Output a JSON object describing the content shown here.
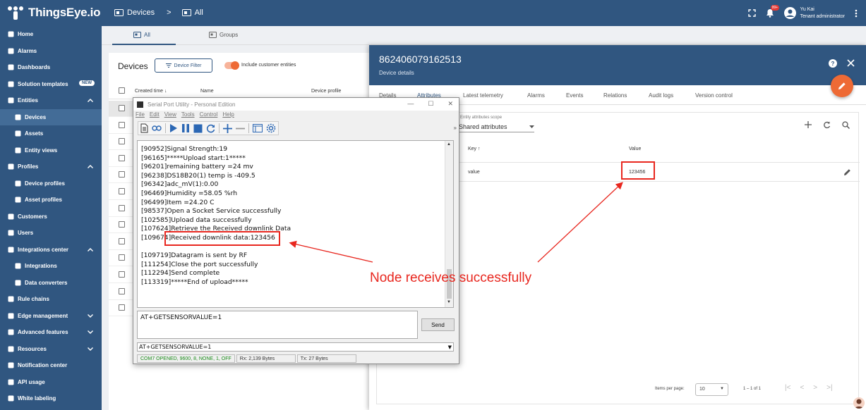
{
  "topbar": {
    "logo_text": "ThingsEye.io",
    "crumb1": "Devices",
    "crumb_sep": ">",
    "crumb2": "All",
    "notif_badge": "99+",
    "user_name": "Yu Kai",
    "user_role": "Tenant administrator"
  },
  "sidebar": {
    "items": [
      {
        "label": "Home",
        "icon": "home-icon"
      },
      {
        "label": "Alarms",
        "icon": "alarm-icon"
      },
      {
        "label": "Dashboards",
        "icon": "dashboard-icon"
      },
      {
        "label": "Solution templates",
        "icon": "template-icon",
        "badge": "NEW"
      },
      {
        "label": "Entities",
        "icon": "entities-icon",
        "chevron": "up"
      },
      {
        "label": "Devices",
        "icon": "device-icon",
        "sub": true,
        "active": true
      },
      {
        "label": "Assets",
        "icon": "asset-icon",
        "sub": true
      },
      {
        "label": "Entity views",
        "icon": "entity-view-icon",
        "sub": true
      },
      {
        "label": "Profiles",
        "icon": "profiles-icon",
        "chevron": "up"
      },
      {
        "label": "Device profiles",
        "icon": "device-profile-icon",
        "sub": true
      },
      {
        "label": "Asset profiles",
        "icon": "asset-profile-icon",
        "sub": true
      },
      {
        "label": "Customers",
        "icon": "customers-icon"
      },
      {
        "label": "Users",
        "icon": "users-icon"
      },
      {
        "label": "Integrations center",
        "icon": "integrations-icon",
        "chevron": "up"
      },
      {
        "label": "Integrations",
        "icon": "integration-icon",
        "sub": true
      },
      {
        "label": "Data converters",
        "icon": "converter-icon",
        "sub": true
      },
      {
        "label": "Rule chains",
        "icon": "rule-chain-icon"
      },
      {
        "label": "Edge management",
        "icon": "edge-icon",
        "chevron": "down"
      },
      {
        "label": "Advanced features",
        "icon": "advanced-icon",
        "chevron": "down"
      },
      {
        "label": "Resources",
        "icon": "resources-icon",
        "chevron": "down"
      },
      {
        "label": "Notification center",
        "icon": "notification-icon"
      },
      {
        "label": "API usage",
        "icon": "api-icon"
      },
      {
        "label": "White labeling",
        "icon": "white-label-icon"
      }
    ]
  },
  "main_tabs": {
    "all": "All",
    "groups": "Groups"
  },
  "devices": {
    "title": "Devices",
    "filter_button": "Device Filter",
    "toggle_label": "Include customer entities",
    "col_created": "Created time",
    "col_name": "Name",
    "col_profile": "Device profile",
    "row_count": 13
  },
  "details": {
    "title": "862406079162513",
    "subtitle": "Device details",
    "tabs": [
      "Details",
      "Attributes",
      "Latest telemetry",
      "Alarms",
      "Events",
      "Relations",
      "Audit logs",
      "Version control"
    ],
    "scope_label": "Entity attributes scope",
    "scope_value": "Shared attributes",
    "col_key": "Key",
    "col_value": "Value",
    "attr_key": "value",
    "attr_value": "123456",
    "items_per_page_label": "Items per page:",
    "items_per_page": "10",
    "range": "1 – 1 of 1"
  },
  "serial": {
    "title": "Serial Port Utility - Personal Edition",
    "menu": [
      "File",
      "Edit",
      "View",
      "Tools",
      "Control",
      "Help"
    ],
    "log_lines": [
      "[90952]Signal Strength:19",
      "[96165]*****Upload start:1*****",
      "[96201]remaining battery =24 mv",
      "[96238]DS18B20(1) temp is -409.5",
      "[96342]adc_mV(1):0.00",
      "[96469]Humidity =58.05 %rh",
      "[96499]Item =24.20 C",
      "[98537]Open a Socket Service successfully",
      "[102585]Upload data successfully",
      "[107624]Retrieve the Received downlink Data",
      "[109674]Received downlink data:123456",
      "",
      "[109719]Datagram is sent by RF",
      "[111254]Close the port successfully",
      "[112294]Send complete",
      "[113319]*****End of upload*****"
    ],
    "input_text": "AT+GETSENSORVALUE=1",
    "send_label": "Send",
    "combo_text": "AT+GETSENSORVALUE=1",
    "status_port": "COM7 OPENED, 9600, 8, NONE, 1, OFF",
    "status_rx": "Rx: 2,139 Bytes",
    "status_tx": "Tx: 27 Bytes"
  },
  "annotation": {
    "text": "Node receives successfully",
    "color": "#e8271f"
  },
  "colors": {
    "primary": "#305680",
    "accent": "#ee6a35",
    "annotation": "#e8271f"
  }
}
